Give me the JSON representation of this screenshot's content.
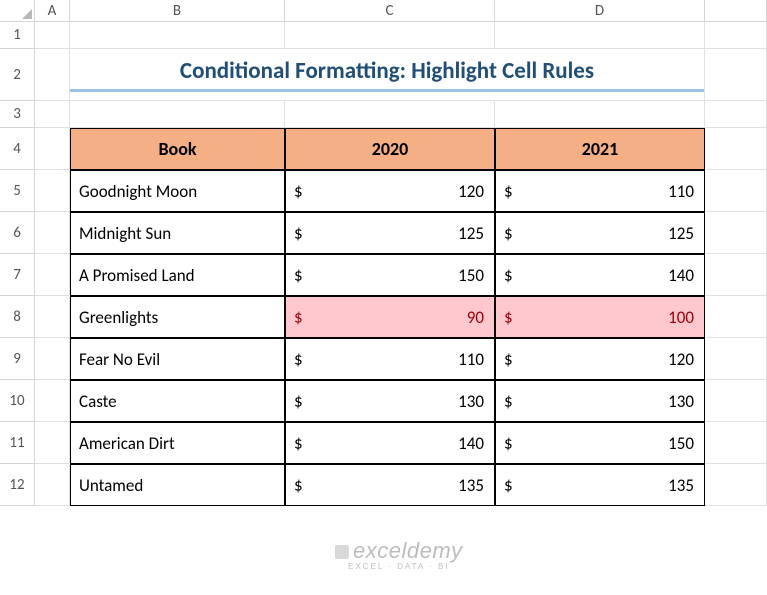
{
  "columns": [
    "A",
    "B",
    "C",
    "D"
  ],
  "row_numbers": [
    1,
    2,
    3,
    4,
    5,
    6,
    7,
    8,
    9,
    10,
    11,
    12
  ],
  "title": "Conditional Formatting: Highlight Cell Rules",
  "headers": {
    "book": "Book",
    "y2020": "2020",
    "y2021": "2021"
  },
  "currency": "$",
  "rows": [
    {
      "book": "Goodnight Moon",
      "y2020": 120,
      "y2021": 110,
      "hl2020": false,
      "hl2021": false
    },
    {
      "book": "Midnight Sun",
      "y2020": 125,
      "y2021": 125,
      "hl2020": false,
      "hl2021": false
    },
    {
      "book": "A Promised Land",
      "y2020": 150,
      "y2021": 140,
      "hl2020": false,
      "hl2021": false
    },
    {
      "book": "Greenlights",
      "y2020": 90,
      "y2021": 100,
      "hl2020": true,
      "hl2021": true
    },
    {
      "book": "Fear No Evil",
      "y2020": 110,
      "y2021": 120,
      "hl2020": false,
      "hl2021": false
    },
    {
      "book": "Caste",
      "y2020": 130,
      "y2021": 130,
      "hl2020": false,
      "hl2021": false
    },
    {
      "book": "American Dirt",
      "y2020": 140,
      "y2021": 150,
      "hl2020": false,
      "hl2021": false
    },
    {
      "book": "Untamed",
      "y2020": 135,
      "y2021": 135,
      "hl2020": false,
      "hl2021": false
    }
  ],
  "watermark": {
    "line1": "exceldemy",
    "line2": "EXCEL · DATA · BI"
  },
  "chart_data": {
    "type": "table",
    "title": "Conditional Formatting: Highlight Cell Rules",
    "columns": [
      "Book",
      "2020",
      "2021"
    ],
    "data": [
      [
        "Goodnight Moon",
        120,
        110
      ],
      [
        "Midnight Sun",
        125,
        125
      ],
      [
        "A Promised Land",
        150,
        140
      ],
      [
        "Greenlights",
        90,
        100
      ],
      [
        "Fear No Evil",
        110,
        120
      ],
      [
        "Caste",
        130,
        130
      ],
      [
        "American Dirt",
        140,
        150
      ],
      [
        "Untamed",
        135,
        135
      ]
    ],
    "highlight_rule": "values less than or equal to 100 highlighted in light red fill with dark red text"
  }
}
